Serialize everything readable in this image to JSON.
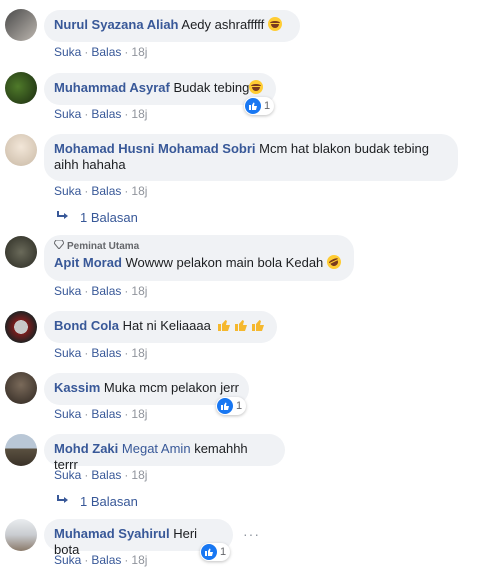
{
  "actions": {
    "like": "Suka",
    "reply": "Balas",
    "sep": "·"
  },
  "comments": [
    {
      "name": "Nurul Syazana Aliah",
      "text": "Aedy ashrafffff",
      "emoji": "laughing-emoji",
      "time": "18j"
    },
    {
      "name": "Muhammad Asyraf",
      "text": "Budak tebing",
      "emoji": "laughing-emoji",
      "time": "18j",
      "reactions": "1"
    },
    {
      "name": "Mohamad Husni Mohamad Sobri",
      "text": "Mcm hat blakon budak tebing aihh hahaha",
      "time": "18j",
      "replies": "1 Balasan"
    },
    {
      "badge": "Peminat Utama",
      "name": "Apit Morad",
      "text": "Wowww pelakon main bola Kedah",
      "emoji": "rofl-emoji",
      "time": "18j"
    },
    {
      "name": "Bond Cola",
      "text": "Hat ni Keliaaaa",
      "emoji": "thumbs-up-emoji x3",
      "time": "18j"
    },
    {
      "name": "Kassim",
      "text": "Muka mcm pelakon jerr",
      "time": "18j",
      "reactions": "1"
    },
    {
      "name": "Mohd Zaki",
      "tag": "Megat Amin",
      "text": "kemahhh terrr",
      "time": "18j",
      "replies": "1 Balasan"
    },
    {
      "name": "Muhamad Syahirul",
      "text": "Heri bota",
      "time": "18j",
      "reactions": "1",
      "more": "···"
    }
  ],
  "colors": {
    "link": "#385898",
    "bubble": "#f0f2f5",
    "like": "#1877f2"
  }
}
